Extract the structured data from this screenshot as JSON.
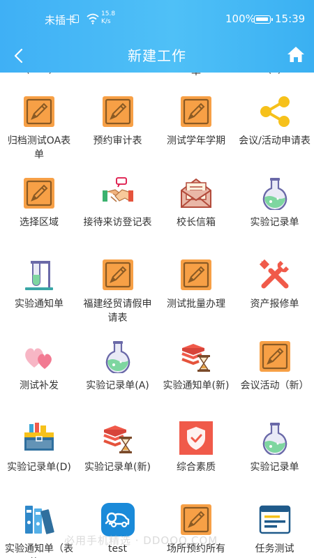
{
  "status_bar": {
    "carrier": "未插卡",
    "net_speed_value": "15.8",
    "net_speed_unit": "K/s",
    "battery": "100%",
    "time": "15:39"
  },
  "header": {
    "title": "新建工作"
  },
  "partial_row": [
    "(test)",
    "",
    "单",
    "(T)"
  ],
  "tiles": [
    {
      "label": "归档测试OA表单",
      "icon": "pencil-form"
    },
    {
      "label": "预约审计表",
      "icon": "pencil-form"
    },
    {
      "label": "测试学年学期",
      "icon": "pencil-form"
    },
    {
      "label": "会议/活动申请表",
      "icon": "share"
    },
    {
      "label": "选择区域",
      "icon": "pencil-form"
    },
    {
      "label": "接待来访登记表",
      "icon": "handshake"
    },
    {
      "label": "校长信箱",
      "icon": "envelope"
    },
    {
      "label": "实验记录单",
      "icon": "flask"
    },
    {
      "label": "实验通知单",
      "icon": "test-tube-stand"
    },
    {
      "label": "福建经贸请假申请表",
      "icon": "pencil-form"
    },
    {
      "label": "测试批量办理",
      "icon": "pencil-form"
    },
    {
      "label": "资产报修单",
      "icon": "tools"
    },
    {
      "label": "测试补发",
      "icon": "hearts"
    },
    {
      "label": "实验记录单(A)",
      "icon": "flask"
    },
    {
      "label": "实验通知单(新)",
      "icon": "books-hourglass"
    },
    {
      "label": "会议活动（新）",
      "icon": "pencil-form"
    },
    {
      "label": "实验记录单(D)",
      "icon": "toolbox"
    },
    {
      "label": "实验记录单(新)",
      "icon": "books-hourglass"
    },
    {
      "label": "综合素质",
      "icon": "shield"
    },
    {
      "label": "实验记录单",
      "icon": "flask"
    },
    {
      "label": "实验通知单（表格...",
      "icon": "binders"
    },
    {
      "label": "test",
      "icon": "search-car"
    },
    {
      "label": "场所预约所有",
      "icon": "pencil-form"
    },
    {
      "label": "任务测试",
      "icon": "task-window"
    }
  ],
  "watermark": "必用手机精选 · DDOOO.COM",
  "colors": {
    "header": "#45b8f6",
    "form_orange": "#f7a046",
    "flask_green": "#7ed6a0",
    "red": "#f05a4a"
  }
}
